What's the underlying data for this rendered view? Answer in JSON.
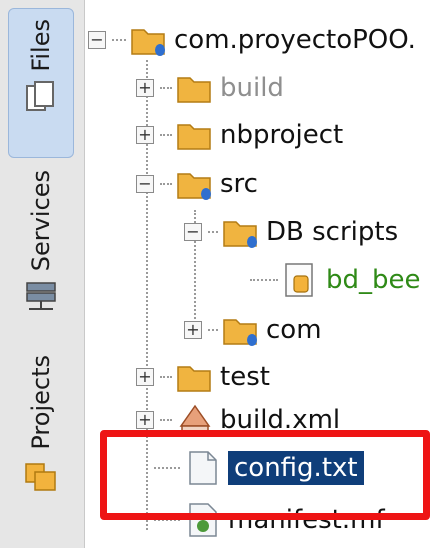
{
  "side_tabs": [
    {
      "label": "Files",
      "active": true,
      "icon": "files-icon"
    },
    {
      "label": "Services",
      "active": false,
      "icon": "services-icon"
    },
    {
      "label": "Projects",
      "active": false,
      "icon": "projects-icon"
    }
  ],
  "tree": {
    "root": {
      "label": "com.proyectoPOO.",
      "expander": "−",
      "icon": "package-folder-icon"
    },
    "build": {
      "label": "build",
      "expander": "+",
      "icon": "folder-icon"
    },
    "nbproject": {
      "label": "nbproject",
      "expander": "+",
      "icon": "folder-icon"
    },
    "src": {
      "label": "src",
      "expander": "−",
      "icon": "package-folder-icon"
    },
    "db_scripts": {
      "label": "DB scripts",
      "expander": "−",
      "icon": "package-folder-icon"
    },
    "bd_bee": {
      "label": "bd_bee",
      "icon": "sql-file-icon"
    },
    "com": {
      "label": "com",
      "expander": "+",
      "icon": "package-folder-icon"
    },
    "test": {
      "label": "test",
      "expander": "+",
      "icon": "folder-icon"
    },
    "build_xml": {
      "label": "build.xml",
      "expander": "+",
      "icon": "ant-build-icon"
    },
    "config_txt": {
      "label": "config.txt",
      "icon": "text-file-icon",
      "selected": true
    },
    "manifest": {
      "label": "manifest.mf",
      "icon": "manifest-file-icon"
    }
  },
  "colors": {
    "highlight": "#ee1414",
    "selection": "#0f3e7a",
    "sql_label": "#2f8a17"
  }
}
